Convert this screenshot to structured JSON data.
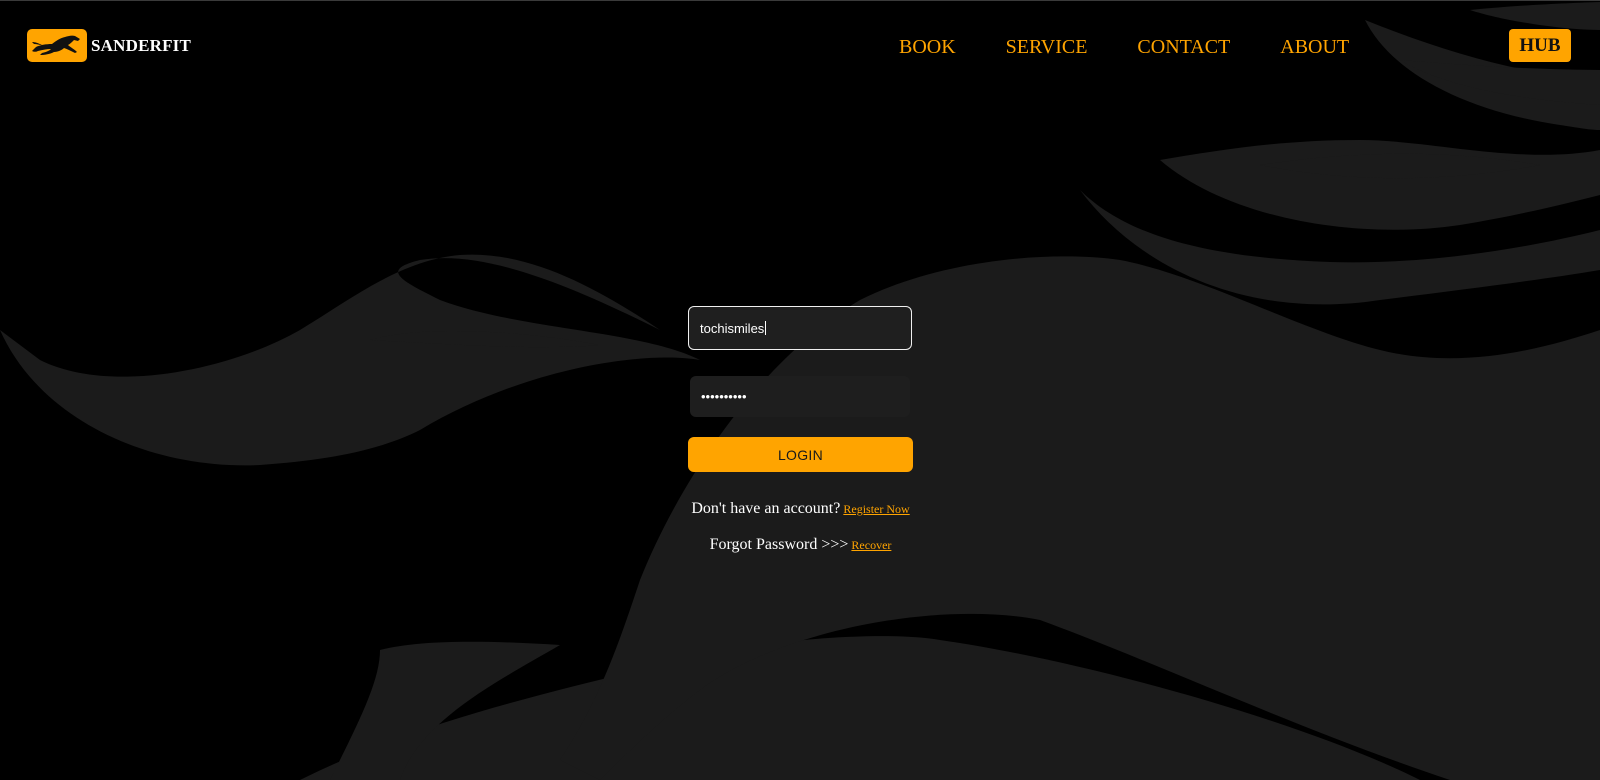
{
  "header": {
    "brand_name": "SANDERFIT",
    "logo_icon": "horse-icon",
    "nav": [
      {
        "label": "BOOK"
      },
      {
        "label": "SERVICE"
      },
      {
        "label": "CONTACT"
      },
      {
        "label": "ABOUT"
      }
    ],
    "hub_label": "HUB"
  },
  "login_form": {
    "username_value": "tochismiles",
    "password_masked": "••••••••••",
    "login_label": "LOGIN",
    "register_prompt": "Don't have an account?",
    "register_link": "Register Now",
    "forgot_prompt": "Forgot Password >>>",
    "recover_link": "Recover"
  },
  "colors": {
    "accent": "#ffa400",
    "background": "#000000",
    "background_art": "#1b1b1b",
    "input_bg": "#1f1f1f"
  }
}
